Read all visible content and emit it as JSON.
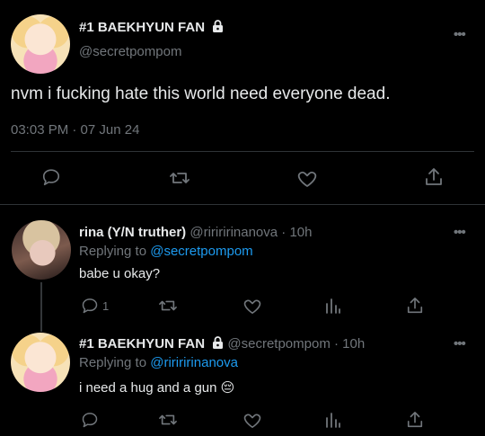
{
  "main_tweet": {
    "display_name": "#1 BAEKHYUN FAN",
    "handle": "@secretpompom",
    "text": "nvm i fucking hate this world need everyone dead.",
    "timestamp": "03:03 PM · 07 Jun 24"
  },
  "reply1": {
    "display_name": "rina (Y/N truther)",
    "handle_time": "@ririririnanova · 10h",
    "replying_prefix": "Replying to ",
    "replying_to": "@secretpompom",
    "text": "babe u okay?",
    "reply_count": "1"
  },
  "reply2": {
    "display_name": "#1 BAEKHYUN FAN",
    "handle_time": "@secretpompom · 10h",
    "replying_prefix": "Replying to ",
    "replying_to": "@ririririnanova",
    "text": "i need a hug and a gun 😔"
  },
  "icons": [
    "reply-icon",
    "retweet-icon",
    "like-icon",
    "share-icon",
    "analytics-icon",
    "more-icon",
    "lock-icon"
  ],
  "colors": {
    "background": "#000000",
    "text": "#e7e9ea",
    "muted": "#71767b",
    "link": "#1d9bf0",
    "divider": "#2f3336"
  }
}
